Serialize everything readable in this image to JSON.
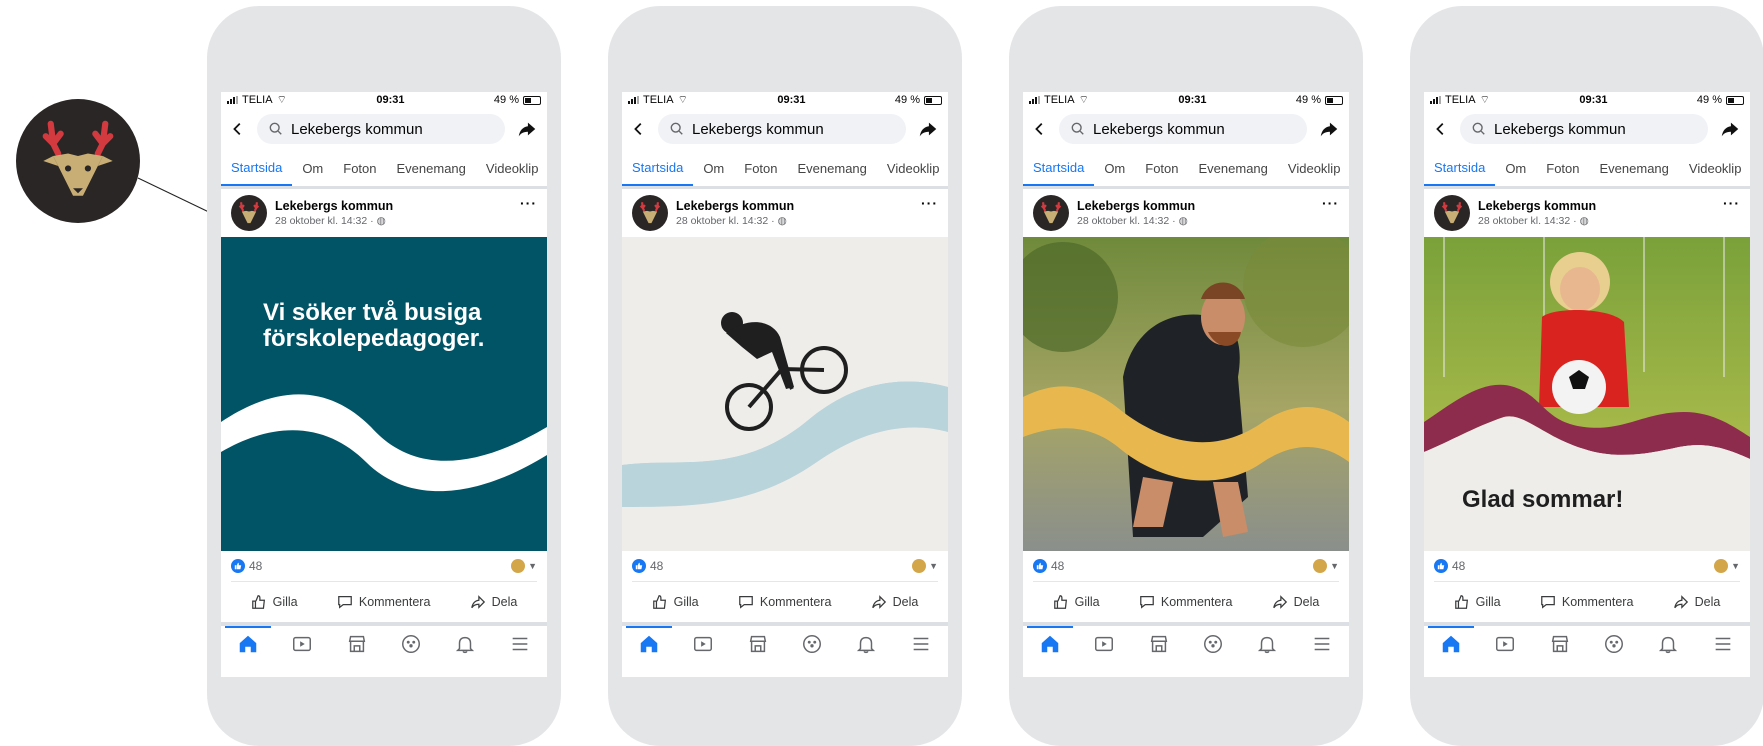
{
  "colors": {
    "accent": "#1877f2",
    "teal": "#005466",
    "light_blue_wave": "#b9d4da",
    "yellow_wave": "#e8b84f",
    "burgundy_wave": "#8e2c4d",
    "soft_bg": "#efedea"
  },
  "status": {
    "carrier": "TELIA",
    "time": "09:31",
    "battery": "49 %"
  },
  "search": {
    "query": "Lekebergs kommun"
  },
  "tabs": [
    "Startsida",
    "Om",
    "Foton",
    "Evenemang",
    "Videoklip"
  ],
  "post": {
    "author": "Lekebergs kommun",
    "timestamp": "28 oktober kl. 14:32 ·",
    "reaction_count": "48"
  },
  "actions": {
    "like": "Gilla",
    "comment": "Kommentera",
    "share": "Dela"
  },
  "nav_icons": [
    "home-icon",
    "video-icon",
    "marketplace-icon",
    "groups-icon",
    "bell-icon",
    "menu-icon"
  ],
  "phones": [
    {
      "headline_line1": "Vi söker två busiga",
      "headline_line2": "förskolepedagoger.",
      "image": "teal background with white wave"
    },
    {
      "image": "cyclist silhouette with light blue wave"
    },
    {
      "image": "bearded runner with yellow wave"
    },
    {
      "caption": "Glad sommar!",
      "image": "child holding soccer ball with burgundy wave"
    }
  ]
}
